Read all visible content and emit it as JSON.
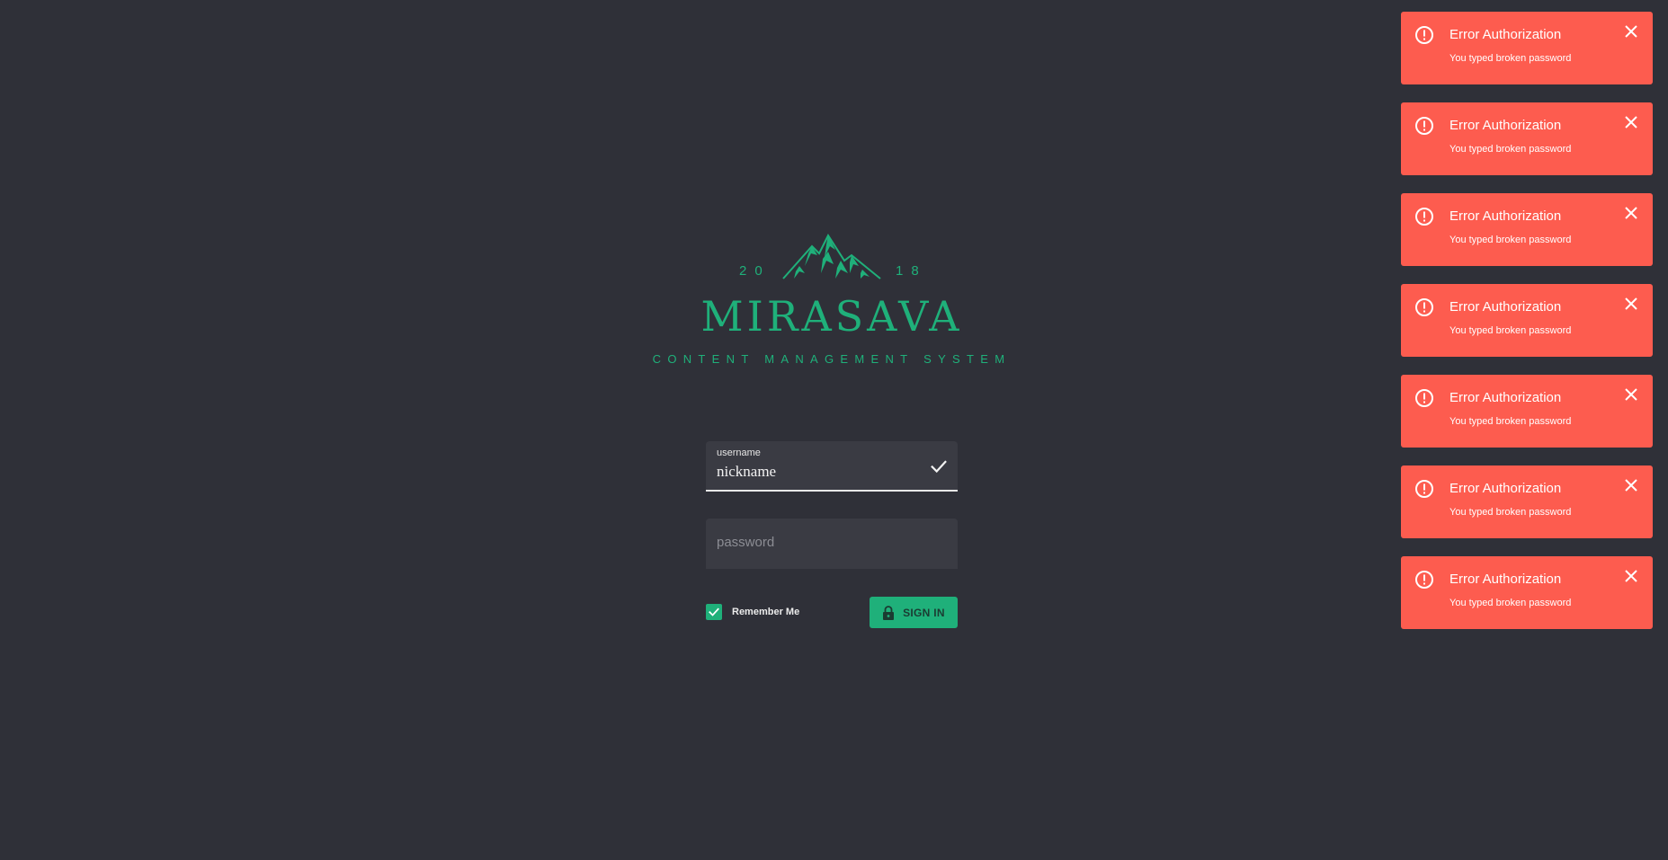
{
  "brand": {
    "year_left": "20",
    "year_right": "18",
    "name": "MIRASAVA",
    "tagline": "CONTENT MANAGEMENT SYSTEM",
    "accent_color": "#1fb07a"
  },
  "form": {
    "username": {
      "label": "username",
      "value": "nickname",
      "status_icon": "check-icon"
    },
    "password": {
      "placeholder": "password",
      "value": ""
    },
    "remember": {
      "label": "Remember Me",
      "checked": true
    },
    "signin": {
      "label": "SIGN IN",
      "icon": "lock-icon"
    }
  },
  "toasts": [
    {
      "title": "Error Authorization",
      "message": "You typed broken password"
    },
    {
      "title": "Error Authorization",
      "message": "You typed broken password"
    },
    {
      "title": "Error Authorization",
      "message": "You typed broken password"
    },
    {
      "title": "Error Authorization",
      "message": "You typed broken password"
    },
    {
      "title": "Error Authorization",
      "message": "You typed broken password"
    },
    {
      "title": "Error Authorization",
      "message": "You typed broken password"
    },
    {
      "title": "Error Authorization",
      "message": "You typed broken password"
    }
  ],
  "colors": {
    "background": "#2f3038",
    "field_background": "#3a3b43",
    "toast_background": "#fd5c4f",
    "accent": "#1fb07a"
  }
}
